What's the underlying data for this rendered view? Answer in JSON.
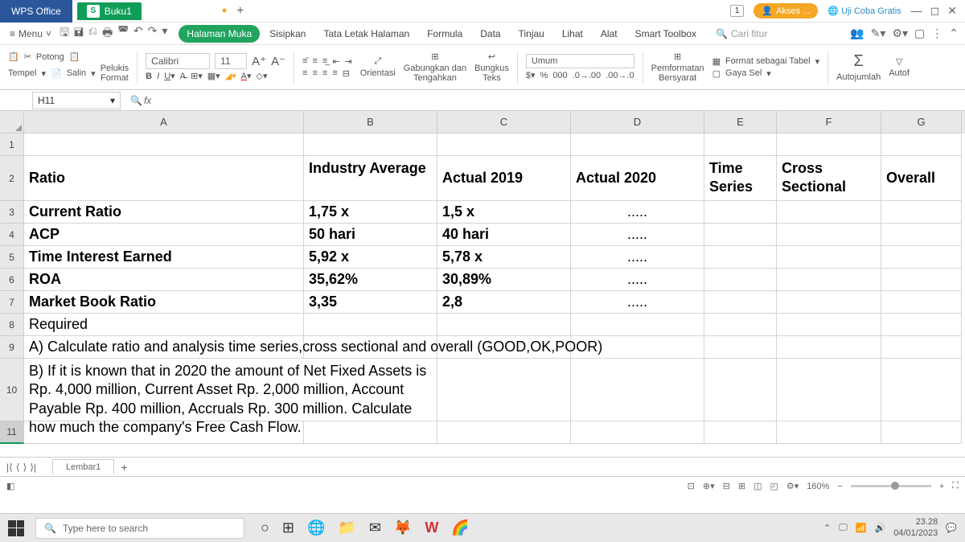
{
  "titlebar": {
    "app": "WPS Office",
    "file_icon": "S",
    "filename": "Buku1",
    "akses": "Akses ...",
    "trial": "Uji Coba Gratis",
    "page_icon": "1"
  },
  "menubar": {
    "menu": "Menu",
    "tabs": [
      "Halaman Muka",
      "Sisipkan",
      "Tata Letak Halaman",
      "Formula",
      "Data",
      "Tinjau",
      "Lihat",
      "Alat",
      "Smart Toolbox"
    ],
    "search_placeholder": "Cari fitur"
  },
  "ribbon": {
    "tempel": "Tempel",
    "potong": "Potong",
    "salin": "Salin",
    "pelukis_format": "Pelukis\nFormat",
    "font": "Calibri",
    "size": "11",
    "orientasi": "Orientasi",
    "gabung": "Gabungkan dan\nTengahkan",
    "bungkus": "Bungkus\nTeks",
    "umum": "Umum",
    "pemformatan": "Pemformatan\nBersyarat",
    "format_tabel": "Format sebagai Tabel",
    "gaya_sel": "Gaya Sel",
    "autojumlah": "Autojumlah",
    "autofilter": "Autof"
  },
  "formula": {
    "cell_ref": "H11",
    "fx": "fx"
  },
  "columns": [
    "A",
    "B",
    "C",
    "D",
    "E",
    "F",
    "G"
  ],
  "rows": [
    "1",
    "2",
    "3",
    "4",
    "5",
    "6",
    "7",
    "8",
    "9",
    "10",
    "11"
  ],
  "cells": {
    "A2": "Ratio",
    "B2": "Industry Average",
    "C2": "Actual 2019",
    "D2": "Actual 2020",
    "E2": "Time Series",
    "F2": "Cross Sectional",
    "G2": "Overall",
    "A3": "Current Ratio",
    "B3": "1,75 x",
    "C3": "1,5 x",
    "D3": ".....",
    "A4": "ACP",
    "B4": "50 hari",
    "C4": "40 hari",
    "D4": ".....",
    "A5": "Time Interest Earned",
    "B5": "5,92 x",
    "C5": "5,78 x",
    "D5": ".....",
    "A6": "ROA",
    "B6": "35,62%",
    "C6": "30,89%",
    "D6": ".....",
    "A7": "Market Book Ratio",
    "B7": "3,35",
    "C7": "2,8",
    "D7": ".....",
    "A8": "Required",
    "A9": "A) Calculate ratio and analysis time series,cross sectional and overall (GOOD,OK,POOR)",
    "A10": "B) If it is known that in 2020 the amount of Net Fixed Assets is Rp. 4,000 million, Current Asset Rp. 2,000 million, Account Payable Rp. 400 million, Accruals Rp. 300 million. Calculate how much the company's Free Cash Flow."
  },
  "sheet": {
    "name": "Lembar1",
    "zoom": "160%"
  },
  "taskbar": {
    "search": "Type here to search",
    "time": "23.28",
    "date": "04/01/2023"
  }
}
